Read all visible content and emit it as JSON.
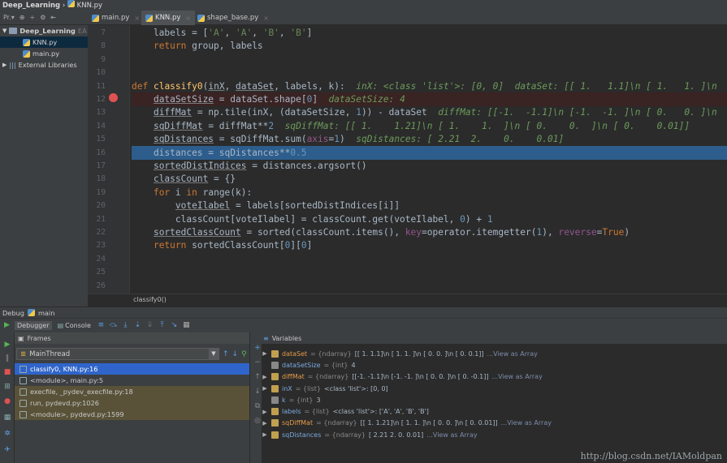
{
  "titlebar": {
    "project": "Deep_Learning",
    "file": "KNN.py"
  },
  "toolbar": {
    "project_view": "Pr.▾"
  },
  "tabs": [
    {
      "label": "main.py",
      "active": false
    },
    {
      "label": "KNN.py",
      "active": true
    },
    {
      "label": "shape_base.py",
      "active": false
    }
  ],
  "project_tree": {
    "root": "Deep_Learning",
    "root_hint": "EA",
    "files": [
      "KNN.py",
      "main.py"
    ],
    "external": "External Libraries"
  },
  "editor": {
    "lines": [
      {
        "n": "7",
        "html": "    labels = [<span class='st'>'A'</span>, <span class='st'>'A'</span>, <span class='st'>'B'</span>, <span class='st'>'B'</span>]"
      },
      {
        "n": "8",
        "html": "    <span class='kw'>return</span> group, labels"
      },
      {
        "n": "9",
        "html": ""
      },
      {
        "n": "10",
        "html": ""
      },
      {
        "n": "11",
        "html": "<span class='kw'>def</span> <span class='fn'>classify0</span>(<span class='und'>inX</span>, <span class='und'>dataSet</span>, labels, k):  <span class='hint'>inX: &lt;class 'list'&gt;: [0, 0]  dataSet: [[ 1.   1.1]\\n [ 1.   1. ]\\n</span>"
      },
      {
        "n": "12",
        "html": "    <span class='und'>dataSetSize</span> = dataSet.shape[<span class='nm'>0</span>]  <span class='hint'>dataSetSize: 4</span>",
        "bp": true
      },
      {
        "n": "13",
        "html": "    <span class='und'>diffMat</span> = np.tile(inX, (dataSetSize, <span class='nm'>1</span>)) - dataSet  <span class='hint'>diffMat: [[-1.  -1.1]\\n [-1.  -1. ]\\n [ 0.   0. ]\\n</span>"
      },
      {
        "n": "14",
        "html": "    <span class='und'>sqDiffMat</span> = diffMat**<span class='nm'>2</span>  <span class='hint'>sqDiffMat: [[ 1.    1.21]\\n [ 1.    1.  ]\\n [ 0.    0.  ]\\n [ 0.    0.01]]</span>"
      },
      {
        "n": "15",
        "html": "    <span class='und'>sqDistances</span> = sqDiffMat.sum(<span class='mg'>axis</span>=<span class='nm'>1</span>)  <span class='hint'>sqDistances: [ 2.21  2.    0.    0.01]</span>"
      },
      {
        "n": "16",
        "html": "    distances = sqDistances**<span class='nm'>0.5</span>",
        "exec": true
      },
      {
        "n": "17",
        "html": "    <span class='und'>sortedDistIndices</span> = distances.argsort()"
      },
      {
        "n": "18",
        "html": "    <span class='und'>classCount</span> = {}"
      },
      {
        "n": "19",
        "html": "    <span class='kw'>for</span> i <span class='kw'>in</span> range(k):"
      },
      {
        "n": "20",
        "html": "        <span class='und'>voteIlabel</span> = labels[sortedDistIndices[i]]"
      },
      {
        "n": "21",
        "html": "        classCount[voteIlabel] = classCount.get(voteIlabel, <span class='nm'>0</span>) + <span class='nm'>1</span>"
      },
      {
        "n": "22",
        "html": "    <span class='und'>sortedClassCount</span> = sorted(classCount.items(), <span class='mg'>key</span>=operator.itemgetter(<span class='nm'>1</span>), <span class='mg'>reverse</span>=<span class='kw'>True</span>)"
      },
      {
        "n": "23",
        "html": "    <span class='kw'>return</span> sortedClassCount[<span class='nm'>0</span>][<span class='nm'>0</span>]"
      },
      {
        "n": "24",
        "html": ""
      },
      {
        "n": "25",
        "html": ""
      },
      {
        "n": "26",
        "html": ""
      }
    ]
  },
  "breadcrumb": "classify0()",
  "debug": {
    "title": "Debug",
    "config": "main",
    "tabs": [
      "Debugger",
      "Console"
    ],
    "frames_title": "Frames",
    "variables_title": "Variables",
    "thread": "MainThread",
    "frames": [
      {
        "label": "classify0, KNN.py:16",
        "kind": "sel"
      },
      {
        "label": "<module>, main.py:5",
        "kind": "user"
      },
      {
        "label": "execfile, _pydev_execfile.py:18",
        "kind": "lib"
      },
      {
        "label": "run, pydevd.py:1026",
        "kind": "lib"
      },
      {
        "label": "<module>, pydevd.py:1599",
        "kind": "lib"
      }
    ],
    "variables": [
      {
        "expand": "▶",
        "name": "dataSet",
        "type": "= {ndarray}",
        "value": "[[ 1.   1.1]\\n [ 1.   1. ]\\n [ 0.   0. ]\\n [ 0.   0.1]]",
        "link": "...View as Array",
        "icon": "arr",
        "color": "o"
      },
      {
        "expand": "",
        "name": "dataSetSize",
        "type": "= {int}",
        "value": "4",
        "link": "",
        "icon": "prim",
        "color": "b"
      },
      {
        "expand": "▶",
        "name": "diffMat",
        "type": "= {ndarray}",
        "value": "[[-1.  -1.1]\\n [-1.  -1. ]\\n [ 0.   0. ]\\n [ 0.  -0.1]]",
        "link": "...View as Array",
        "icon": "arr",
        "color": "o"
      },
      {
        "expand": "▶",
        "name": "inX",
        "type": "= {list}",
        "value": "<class 'list'>: [0, 0]",
        "link": "",
        "icon": "arr",
        "color": "b"
      },
      {
        "expand": "",
        "name": "k",
        "type": "= {int}",
        "value": "3",
        "link": "",
        "icon": "prim",
        "color": "b"
      },
      {
        "expand": "▶",
        "name": "labels",
        "type": "= {list}",
        "value": "<class 'list'>: ['A', 'A', 'B', 'B']",
        "link": "",
        "icon": "arr",
        "color": "b"
      },
      {
        "expand": "▶",
        "name": "sqDiffMat",
        "type": "= {ndarray}",
        "value": "[[ 1.    1.21]\\n [ 1.    1.  ]\\n [ 0.    0.  ]\\n [ 0.    0.01]]",
        "link": "...View as Array",
        "icon": "arr",
        "color": "o"
      },
      {
        "expand": "▶",
        "name": "sqDistances",
        "type": "= {ndarray}",
        "value": "[ 2.21  2.    0.    0.01]",
        "link": "...View as Array",
        "icon": "arr",
        "color": "b"
      }
    ]
  },
  "watermark": "http://blog.csdn.net/IAMoldpan"
}
